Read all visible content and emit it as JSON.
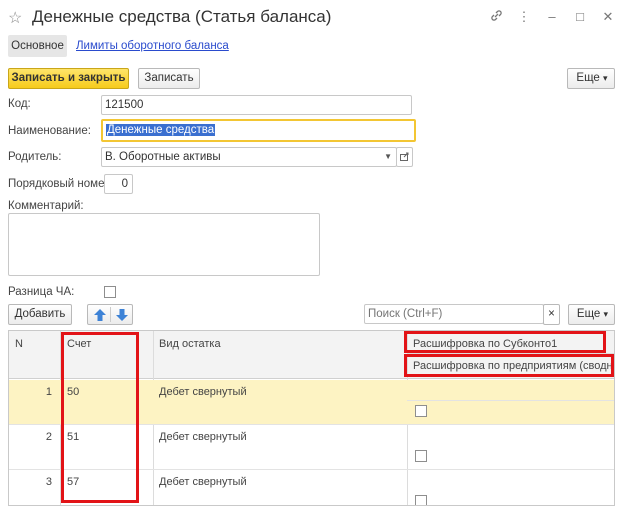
{
  "window": {
    "title": "Денежные средства (Статья  баланса)",
    "icons": [
      "star-icon",
      "link-icon",
      "more-icon",
      "minimize-icon",
      "maximize-icon",
      "close-icon"
    ]
  },
  "tabs": {
    "active": "Основное",
    "link": "Лимиты оборотного баланса"
  },
  "toolbar": {
    "save_close": "Записать и закрыть",
    "save": "Записать",
    "more": "Еще",
    "more_arrow": "▾"
  },
  "form": {
    "code_label": "Код:",
    "code_value": "121500",
    "name_label": "Наименование:",
    "name_value": "Денежные средства",
    "parent_label": "Родитель:",
    "parent_value": "В. Оборотные активы",
    "order_label": "Порядковый номер:",
    "order_value": "0",
    "comment_label": "Комментарий:",
    "diff_label": "Разница ЧА:"
  },
  "table_toolbar": {
    "add": "Добавить",
    "search_placeholder": "Поиск (Ctrl+F)",
    "clear": "×",
    "more": "Еще",
    "more_arrow": "▾"
  },
  "table": {
    "columns": {
      "n": "N",
      "account": "Счет",
      "balance_type": "Вид остатка",
      "subconto": "Расшифровка по Субконто1",
      "enterprises": "Расшифровка по предприятиям (сводный)"
    },
    "rows": [
      {
        "n": "1",
        "account": "50",
        "balance_type": "Дебет свернутый"
      },
      {
        "n": "2",
        "account": "51",
        "balance_type": "Дебет свернутый"
      },
      {
        "n": "3",
        "account": "57",
        "balance_type": "Дебет свернутый"
      }
    ]
  },
  "colors": {
    "primary_button": "#f6cb1c",
    "selected_row": "#fdf3c3",
    "highlight_frame": "#e21317",
    "link": "#2a4bcd"
  }
}
